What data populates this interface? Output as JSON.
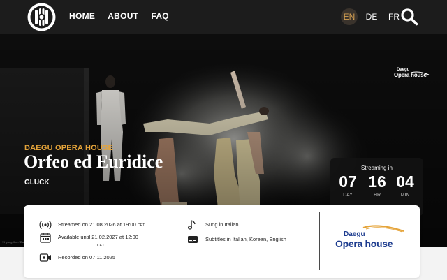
{
  "header": {
    "nav": [
      "HOME",
      "ABOUT",
      "FAQ"
    ],
    "languages": [
      {
        "code": "EN",
        "active": true
      },
      {
        "code": "DE",
        "active": false
      },
      {
        "code": "FR",
        "active": false
      }
    ],
    "logo_icon": "rose-window-logo",
    "search_icon": "search-icon"
  },
  "hero": {
    "venue": "DAEGU OPERA HOUSE",
    "title": "Orfeo ed Euridice",
    "composer": "GLUCK",
    "logo": {
      "line1": "Daegu",
      "line2": "Opera house"
    },
    "credit": "©Hyung Kim / Daegu",
    "countdown": {
      "label": "Streaming in",
      "day": "07",
      "day_unit": "DAY",
      "hr": "16",
      "hr_unit": "HR",
      "min": "04",
      "min_unit": "MIN"
    }
  },
  "info": {
    "streamed_prefix": "Streamed on",
    "streamed_value": "21.08.2026 at 19:00",
    "streamed_tz": "CET",
    "available_prefix": "Available until",
    "available_value": "21.02.2027 at 12:00",
    "available_tz": "CET",
    "recorded_prefix": "Recorded on",
    "recorded_value": "07.11.2025",
    "sung_prefix": "Sung in",
    "sung_value": "Italian",
    "subtitles_prefix": "Subtitles in",
    "subtitles_value": "Italian, Korean, English",
    "partner_logo": {
      "line1": "Daegu",
      "line2": "Opera house"
    }
  },
  "colors": {
    "header_bg": "#1c1c1c",
    "accent": "#e5a43a",
    "brand_blue": "#1d3c8f",
    "brand_orange": "#e5a43a"
  }
}
